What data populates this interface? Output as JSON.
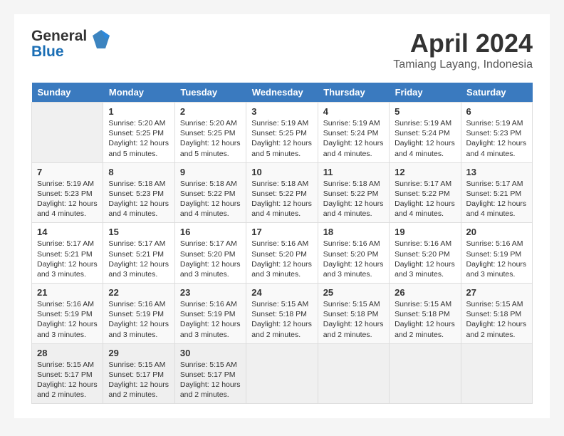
{
  "logo": {
    "line1": "General",
    "line2": "Blue"
  },
  "title": {
    "month_year": "April 2024",
    "location": "Tamiang Layang, Indonesia"
  },
  "headers": [
    "Sunday",
    "Monday",
    "Tuesday",
    "Wednesday",
    "Thursday",
    "Friday",
    "Saturday"
  ],
  "weeks": [
    [
      {
        "day": "",
        "info": ""
      },
      {
        "day": "1",
        "info": "Sunrise: 5:20 AM\nSunset: 5:25 PM\nDaylight: 12 hours\nand 5 minutes."
      },
      {
        "day": "2",
        "info": "Sunrise: 5:20 AM\nSunset: 5:25 PM\nDaylight: 12 hours\nand 5 minutes."
      },
      {
        "day": "3",
        "info": "Sunrise: 5:19 AM\nSunset: 5:25 PM\nDaylight: 12 hours\nand 5 minutes."
      },
      {
        "day": "4",
        "info": "Sunrise: 5:19 AM\nSunset: 5:24 PM\nDaylight: 12 hours\nand 4 minutes."
      },
      {
        "day": "5",
        "info": "Sunrise: 5:19 AM\nSunset: 5:24 PM\nDaylight: 12 hours\nand 4 minutes."
      },
      {
        "day": "6",
        "info": "Sunrise: 5:19 AM\nSunset: 5:23 PM\nDaylight: 12 hours\nand 4 minutes."
      }
    ],
    [
      {
        "day": "7",
        "info": "Sunrise: 5:19 AM\nSunset: 5:23 PM\nDaylight: 12 hours\nand 4 minutes."
      },
      {
        "day": "8",
        "info": "Sunrise: 5:18 AM\nSunset: 5:23 PM\nDaylight: 12 hours\nand 4 minutes."
      },
      {
        "day": "9",
        "info": "Sunrise: 5:18 AM\nSunset: 5:22 PM\nDaylight: 12 hours\nand 4 minutes."
      },
      {
        "day": "10",
        "info": "Sunrise: 5:18 AM\nSunset: 5:22 PM\nDaylight: 12 hours\nand 4 minutes."
      },
      {
        "day": "11",
        "info": "Sunrise: 5:18 AM\nSunset: 5:22 PM\nDaylight: 12 hours\nand 4 minutes."
      },
      {
        "day": "12",
        "info": "Sunrise: 5:17 AM\nSunset: 5:22 PM\nDaylight: 12 hours\nand 4 minutes."
      },
      {
        "day": "13",
        "info": "Sunrise: 5:17 AM\nSunset: 5:21 PM\nDaylight: 12 hours\nand 4 minutes."
      }
    ],
    [
      {
        "day": "14",
        "info": "Sunrise: 5:17 AM\nSunset: 5:21 PM\nDaylight: 12 hours\nand 3 minutes."
      },
      {
        "day": "15",
        "info": "Sunrise: 5:17 AM\nSunset: 5:21 PM\nDaylight: 12 hours\nand 3 minutes."
      },
      {
        "day": "16",
        "info": "Sunrise: 5:17 AM\nSunset: 5:20 PM\nDaylight: 12 hours\nand 3 minutes."
      },
      {
        "day": "17",
        "info": "Sunrise: 5:16 AM\nSunset: 5:20 PM\nDaylight: 12 hours\nand 3 minutes."
      },
      {
        "day": "18",
        "info": "Sunrise: 5:16 AM\nSunset: 5:20 PM\nDaylight: 12 hours\nand 3 minutes."
      },
      {
        "day": "19",
        "info": "Sunrise: 5:16 AM\nSunset: 5:20 PM\nDaylight: 12 hours\nand 3 minutes."
      },
      {
        "day": "20",
        "info": "Sunrise: 5:16 AM\nSunset: 5:19 PM\nDaylight: 12 hours\nand 3 minutes."
      }
    ],
    [
      {
        "day": "21",
        "info": "Sunrise: 5:16 AM\nSunset: 5:19 PM\nDaylight: 12 hours\nand 3 minutes."
      },
      {
        "day": "22",
        "info": "Sunrise: 5:16 AM\nSunset: 5:19 PM\nDaylight: 12 hours\nand 3 minutes."
      },
      {
        "day": "23",
        "info": "Sunrise: 5:16 AM\nSunset: 5:19 PM\nDaylight: 12 hours\nand 3 minutes."
      },
      {
        "day": "24",
        "info": "Sunrise: 5:15 AM\nSunset: 5:18 PM\nDaylight: 12 hours\nand 2 minutes."
      },
      {
        "day": "25",
        "info": "Sunrise: 5:15 AM\nSunset: 5:18 PM\nDaylight: 12 hours\nand 2 minutes."
      },
      {
        "day": "26",
        "info": "Sunrise: 5:15 AM\nSunset: 5:18 PM\nDaylight: 12 hours\nand 2 minutes."
      },
      {
        "day": "27",
        "info": "Sunrise: 5:15 AM\nSunset: 5:18 PM\nDaylight: 12 hours\nand 2 minutes."
      }
    ],
    [
      {
        "day": "28",
        "info": "Sunrise: 5:15 AM\nSunset: 5:17 PM\nDaylight: 12 hours\nand 2 minutes."
      },
      {
        "day": "29",
        "info": "Sunrise: 5:15 AM\nSunset: 5:17 PM\nDaylight: 12 hours\nand 2 minutes."
      },
      {
        "day": "30",
        "info": "Sunrise: 5:15 AM\nSunset: 5:17 PM\nDaylight: 12 hours\nand 2 minutes."
      },
      {
        "day": "",
        "info": ""
      },
      {
        "day": "",
        "info": ""
      },
      {
        "day": "",
        "info": ""
      },
      {
        "day": "",
        "info": ""
      }
    ]
  ]
}
